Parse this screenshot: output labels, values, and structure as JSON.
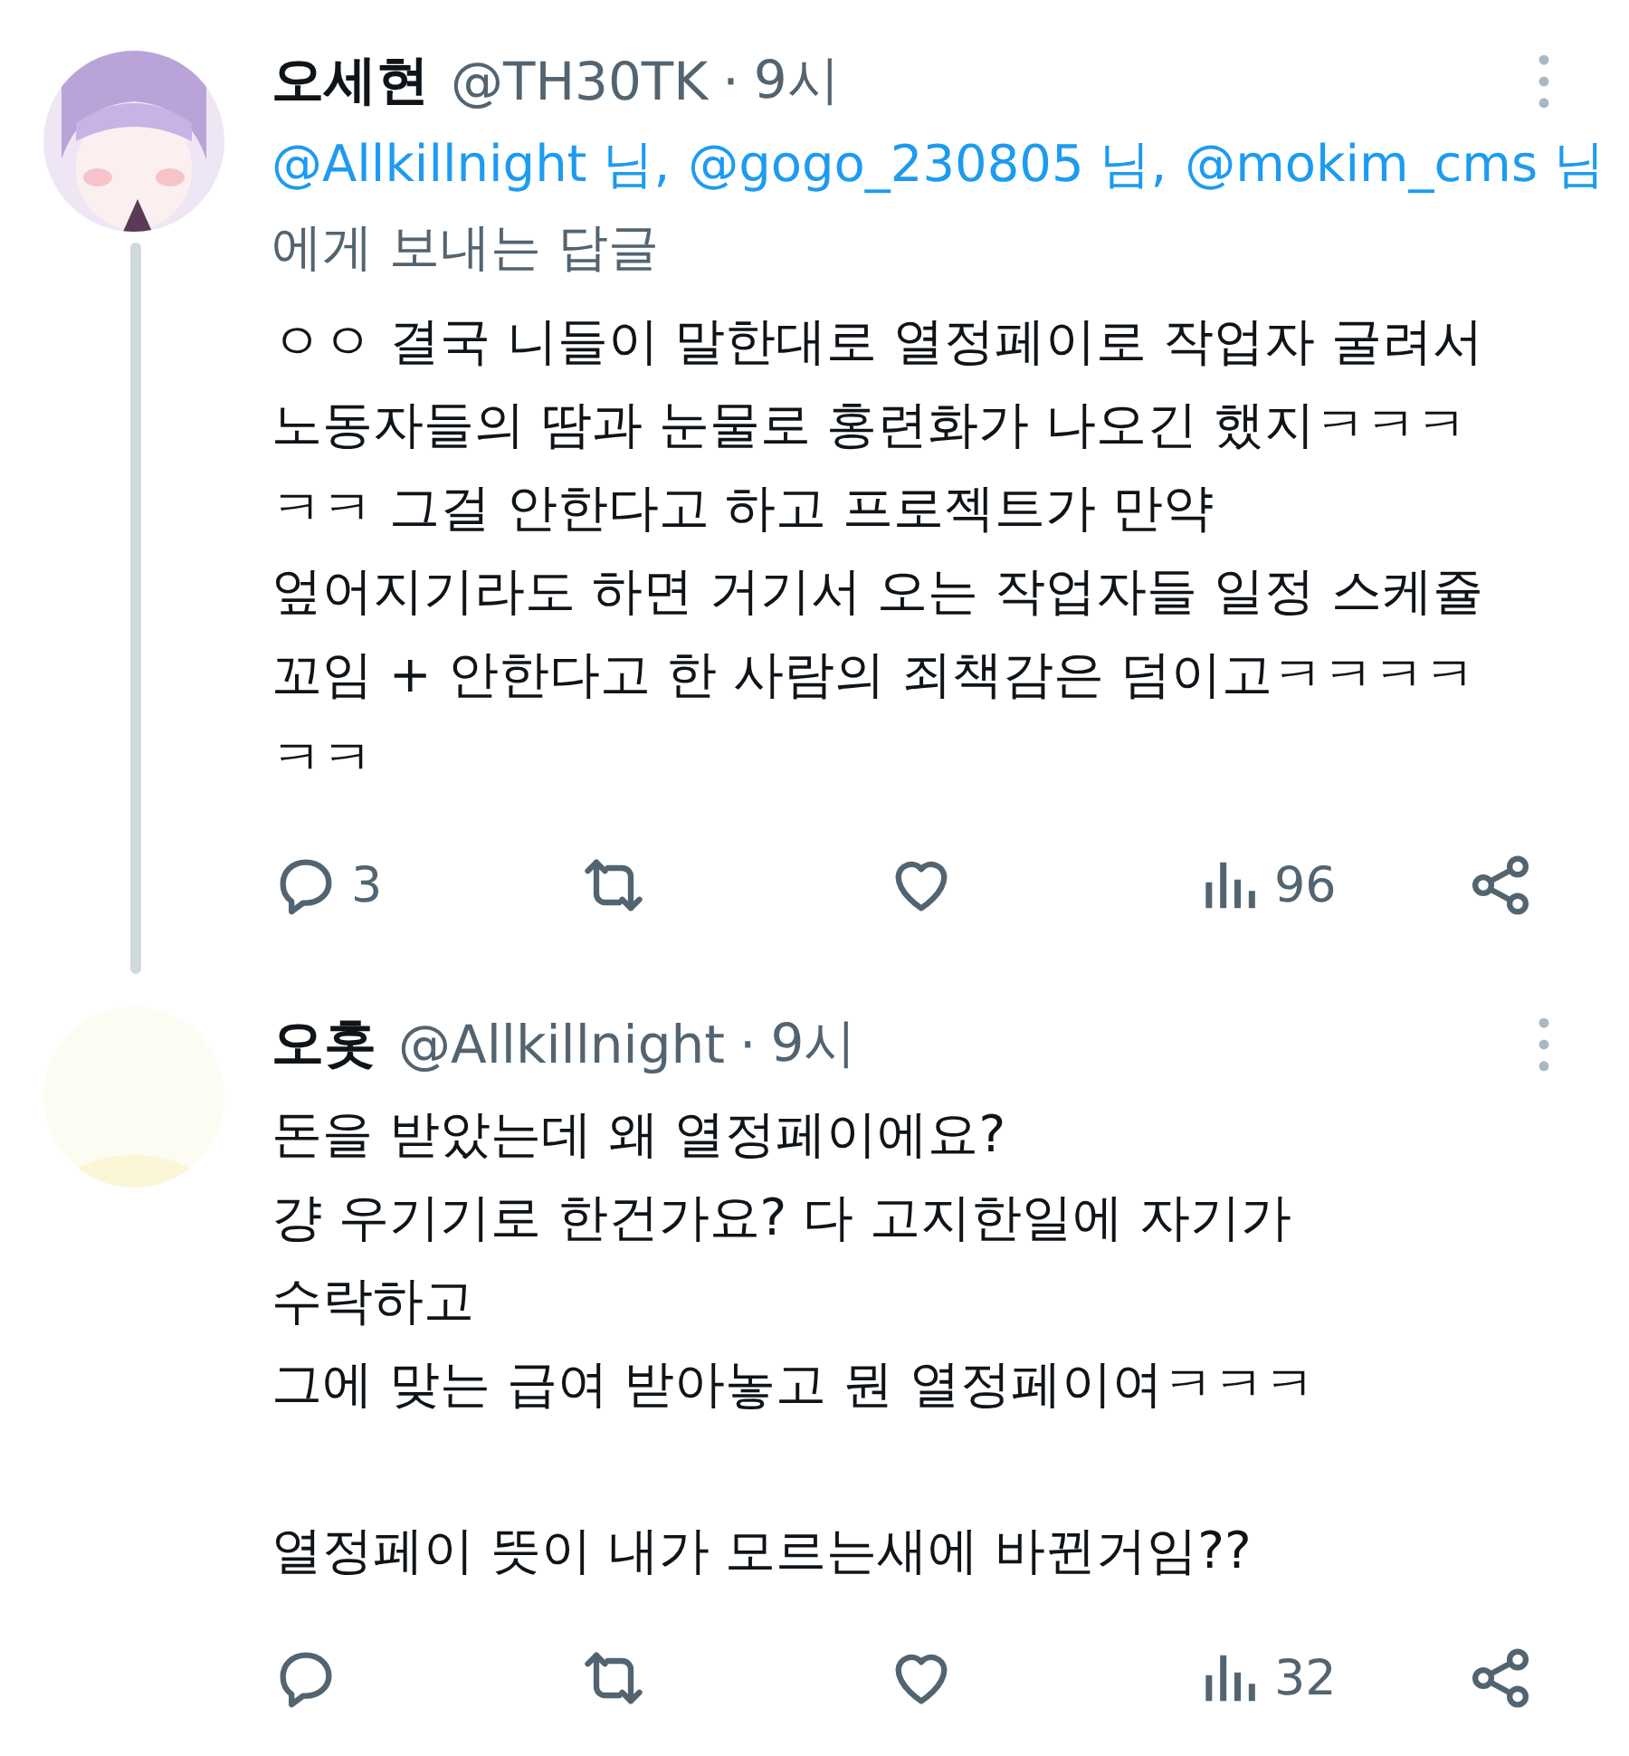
{
  "tweets": [
    {
      "avatar": {
        "kind": "picture"
      },
      "thread_line": true,
      "name": "오세현",
      "handle": "@TH30TK",
      "time": "9시",
      "separator": "·",
      "reply_to": {
        "mentions": [
          "@Allkillnight 님,",
          "@gogo_230805 님,",
          "@mokim_cms 님"
        ],
        "suffix": "에게 보내는 답글"
      },
      "paragraphs": [
        [
          "ㅇㅇ 결국 니들이 말한대로 열정페이로 작업자 굴려서",
          "노동자들의 땀과 눈물로 홍련화가 나오긴 했지ㅋㅋㅋ",
          "ㅋㅋ 그걸 안한다고 하고 프로젝트가 만약",
          "엎어지기라도 하면 거기서 오는 작업자들 일정 스케쥴",
          "꼬임 + 안한다고 한 사람의 죄책감은 덤이고ㅋㅋㅋㅋ",
          "ㅋㅋ"
        ]
      ],
      "actions": {
        "replies": "3",
        "views": "96"
      }
    },
    {
      "avatar": {
        "kind": "picture"
      },
      "thread_line": false,
      "name": "오홋",
      "handle": "@Allkillnight",
      "time": "9시",
      "separator": "·",
      "paragraphs": [
        [
          "돈을 받았는데 왜 열정페이에요?",
          "걍 우기기로 한건가요? 다 고지한일에 자기가",
          "수락하고",
          "그에 맞는 급여 받아놓고 뭔 열정페이여ㅋㅋㅋ"
        ],
        [
          "열정페이 뜻이 내가 모르는새에 바뀐거임??"
        ]
      ],
      "actions": {
        "views": "32"
      }
    }
  ]
}
